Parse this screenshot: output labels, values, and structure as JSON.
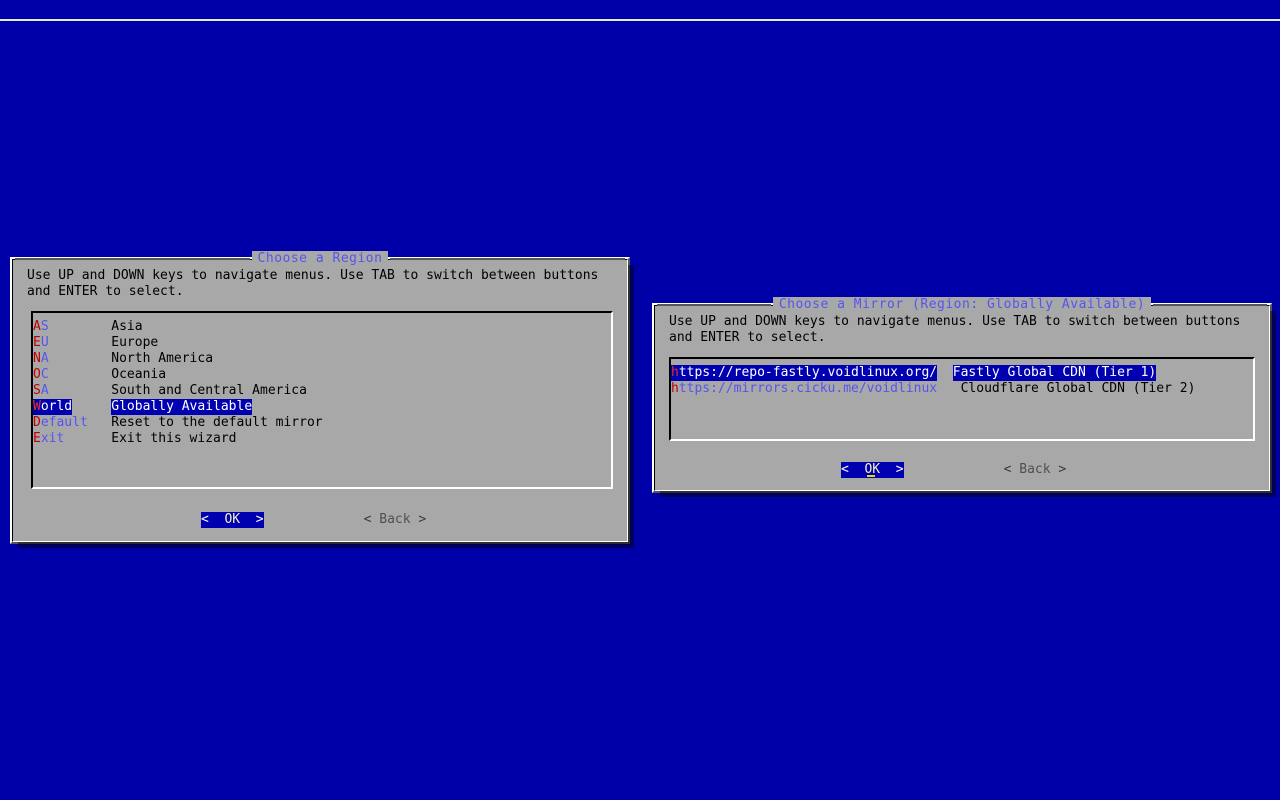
{
  "screen": {
    "background_color": "#0000a8",
    "rule_color": "#e8e8e8"
  },
  "dialogs": [
    {
      "id": "choose-region",
      "title": "Choose a Region",
      "hint": "Use UP and DOWN keys to navigate menus. Use TAB to switch between buttons\nand ENTER to select.",
      "focused": false,
      "list": {
        "items": [
          {
            "tag": "AS",
            "hotkey": "A",
            "desc": "Asia",
            "selected": false
          },
          {
            "tag": "EU",
            "hotkey": "E",
            "desc": "Europe",
            "selected": false
          },
          {
            "tag": "NA",
            "hotkey": "N",
            "desc": "North America",
            "selected": false
          },
          {
            "tag": "OC",
            "hotkey": "O",
            "desc": "Oceania",
            "selected": false
          },
          {
            "tag": "SA",
            "hotkey": "S",
            "desc": "South and Central America",
            "selected": false
          },
          {
            "tag": "World",
            "hotkey": "W",
            "desc": "Globally Available",
            "selected": true
          },
          {
            "tag": "Default",
            "hotkey": "D",
            "desc": "Reset to the default mirror",
            "selected": false
          },
          {
            "tag": "Exit",
            "hotkey": "E",
            "desc": "Exit this wizard",
            "selected": false
          }
        ]
      },
      "buttons": [
        {
          "id": "ok",
          "label": "OK",
          "left_arrow": "<",
          "right_arrow": ">",
          "focused": true,
          "cursor": false
        },
        {
          "id": "back",
          "label": "Back",
          "left_arrow": "<",
          "right_arrow": ">",
          "focused": false,
          "cursor": false
        }
      ]
    },
    {
      "id": "choose-mirror",
      "title": "Choose a Mirror (Region: Globally Available)",
      "hint": "Use UP and DOWN keys to navigate menus. Use TAB to switch between buttons\nand ENTER to select.",
      "focused": true,
      "list": {
        "items": [
          {
            "tag": "https://repo-fastly.voidlinux.org/",
            "hotkey": "h",
            "desc": "Fastly Global CDN (Tier 1)",
            "selected": true
          },
          {
            "tag": "https://mirrors.cicku.me/voidlinux",
            "hotkey": "h",
            "desc": "Cloudflare Global CDN (Tier 2)",
            "selected": false
          }
        ]
      },
      "buttons": [
        {
          "id": "ok",
          "label": "OK",
          "left_arrow": "<",
          "right_arrow": ">",
          "focused": true,
          "cursor": true
        },
        {
          "id": "back",
          "label": "Back",
          "left_arrow": "<",
          "right_arrow": ">",
          "focused": false,
          "cursor": false
        }
      ]
    }
  ],
  "colors": {
    "dialog_face": "#a8a8a8",
    "title": "#5555ee",
    "tag": "#5555ee",
    "hotkey": "#c00000",
    "selection_bg": "#0000b0",
    "selection_fg": "#ffffff",
    "button_label_focused": "#f2f2c0",
    "cursor": "#e0e000"
  }
}
